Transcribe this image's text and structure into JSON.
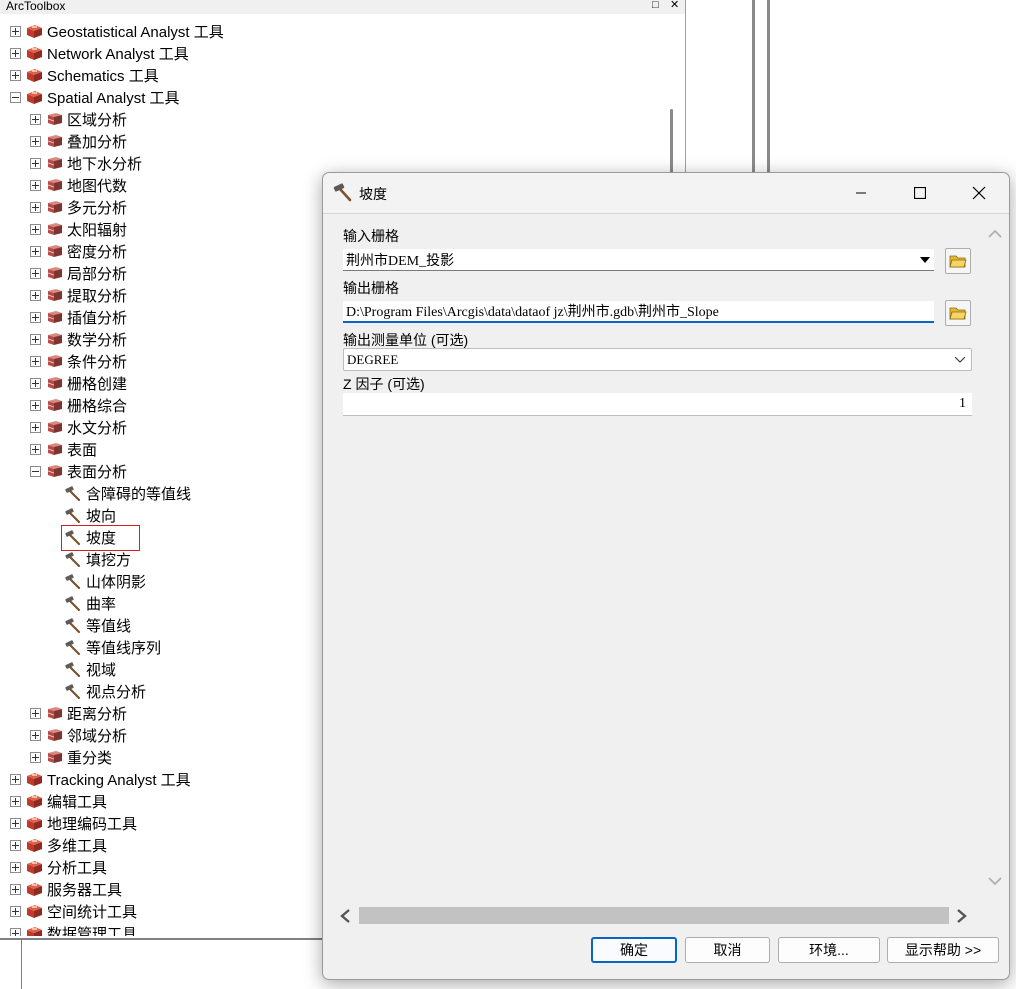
{
  "toolbox": {
    "title": "ArcToolbox",
    "restore_glyph": "□",
    "close_glyph": "✕",
    "items": [
      {
        "label": "Geostatistical Analyst 工具",
        "level": 0,
        "state": "collapsed",
        "icon": "toolbox-icon"
      },
      {
        "label": "Network Analyst 工具",
        "level": 0,
        "state": "collapsed",
        "icon": "toolbox-icon"
      },
      {
        "label": "Schematics 工具",
        "level": 0,
        "state": "collapsed",
        "icon": "toolbox-icon"
      },
      {
        "label": "Spatial Analyst 工具",
        "level": 0,
        "state": "expanded",
        "icon": "toolbox-icon"
      },
      {
        "label": "区域分析",
        "level": 1,
        "state": "collapsed",
        "icon": "toolset-icon"
      },
      {
        "label": "叠加分析",
        "level": 1,
        "state": "collapsed",
        "icon": "toolset-icon"
      },
      {
        "label": "地下水分析",
        "level": 1,
        "state": "collapsed",
        "icon": "toolset-icon"
      },
      {
        "label": "地图代数",
        "level": 1,
        "state": "collapsed",
        "icon": "toolset-icon"
      },
      {
        "label": "多元分析",
        "level": 1,
        "state": "collapsed",
        "icon": "toolset-icon"
      },
      {
        "label": "太阳辐射",
        "level": 1,
        "state": "collapsed",
        "icon": "toolset-icon"
      },
      {
        "label": "密度分析",
        "level": 1,
        "state": "collapsed",
        "icon": "toolset-icon"
      },
      {
        "label": "局部分析",
        "level": 1,
        "state": "collapsed",
        "icon": "toolset-icon"
      },
      {
        "label": "提取分析",
        "level": 1,
        "state": "collapsed",
        "icon": "toolset-icon"
      },
      {
        "label": "插值分析",
        "level": 1,
        "state": "collapsed",
        "icon": "toolset-icon"
      },
      {
        "label": "数学分析",
        "level": 1,
        "state": "collapsed",
        "icon": "toolset-icon"
      },
      {
        "label": "条件分析",
        "level": 1,
        "state": "collapsed",
        "icon": "toolset-icon"
      },
      {
        "label": "栅格创建",
        "level": 1,
        "state": "collapsed",
        "icon": "toolset-icon"
      },
      {
        "label": "栅格综合",
        "level": 1,
        "state": "collapsed",
        "icon": "toolset-icon"
      },
      {
        "label": "水文分析",
        "level": 1,
        "state": "collapsed",
        "icon": "toolset-icon"
      },
      {
        "label": "表面",
        "level": 1,
        "state": "collapsed",
        "icon": "toolset-icon"
      },
      {
        "label": "表面分析",
        "level": 1,
        "state": "expanded",
        "icon": "toolset-icon"
      },
      {
        "label": "含障碍的等值线",
        "level": 2,
        "state": "leaf",
        "icon": "hammer-tool-icon"
      },
      {
        "label": "坡向",
        "level": 2,
        "state": "leaf",
        "icon": "hammer-tool-icon"
      },
      {
        "label": "坡度",
        "level": 2,
        "state": "leaf",
        "icon": "hammer-tool-icon",
        "selected": true
      },
      {
        "label": "填挖方",
        "level": 2,
        "state": "leaf",
        "icon": "hammer-tool-icon"
      },
      {
        "label": "山体阴影",
        "level": 2,
        "state": "leaf",
        "icon": "hammer-tool-icon"
      },
      {
        "label": "曲率",
        "level": 2,
        "state": "leaf",
        "icon": "hammer-tool-icon"
      },
      {
        "label": "等值线",
        "level": 2,
        "state": "leaf",
        "icon": "hammer-tool-icon"
      },
      {
        "label": "等值线序列",
        "level": 2,
        "state": "leaf",
        "icon": "hammer-tool-icon"
      },
      {
        "label": "视域",
        "level": 2,
        "state": "leaf",
        "icon": "hammer-tool-icon"
      },
      {
        "label": "视点分析",
        "level": 2,
        "state": "leaf",
        "icon": "hammer-tool-icon"
      },
      {
        "label": "距离分析",
        "level": 1,
        "state": "collapsed",
        "icon": "toolset-icon"
      },
      {
        "label": "邻域分析",
        "level": 1,
        "state": "collapsed",
        "icon": "toolset-icon"
      },
      {
        "label": "重分类",
        "level": 1,
        "state": "collapsed",
        "icon": "toolset-icon"
      },
      {
        "label": "Tracking Analyst 工具",
        "level": 0,
        "state": "collapsed",
        "icon": "toolbox-icon"
      },
      {
        "label": "编辑工具",
        "level": 0,
        "state": "collapsed",
        "icon": "toolbox-icon"
      },
      {
        "label": "地理编码工具",
        "level": 0,
        "state": "collapsed",
        "icon": "toolbox-icon"
      },
      {
        "label": "多维工具",
        "level": 0,
        "state": "collapsed",
        "icon": "toolbox-icon"
      },
      {
        "label": "分析工具",
        "level": 0,
        "state": "collapsed",
        "icon": "toolbox-icon"
      },
      {
        "label": "服务器工具",
        "level": 0,
        "state": "collapsed",
        "icon": "toolbox-icon"
      },
      {
        "label": "空间统计工具",
        "level": 0,
        "state": "collapsed",
        "icon": "toolbox-icon"
      },
      {
        "label": "数据管理工具",
        "level": 0,
        "state": "collapsed",
        "icon": "toolbox-icon"
      }
    ]
  },
  "dialog": {
    "title": "坡度",
    "input_raster": {
      "label": "输入栅格",
      "value": "荆州市DEM_投影"
    },
    "output_raster": {
      "label": "输出栅格",
      "value": "D:\\Program Files\\Arcgis\\data\\dataof jz\\荆州市.gdb\\荆州市_Slope"
    },
    "output_measurement": {
      "label": "输出测量单位 (可选)",
      "value": "DEGREE"
    },
    "z_factor": {
      "label": "Z 因子 (可选)",
      "value": "1"
    },
    "buttons": {
      "ok": "确定",
      "cancel": "取消",
      "environments": "环境...",
      "show_help": "显示帮助 >>"
    }
  },
  "colors": {
    "selection_outline": "#d02020",
    "default_button_border": "#0a64c4",
    "toolbox_icon": "#c0392b",
    "toolset_icon": "#b94a48"
  }
}
